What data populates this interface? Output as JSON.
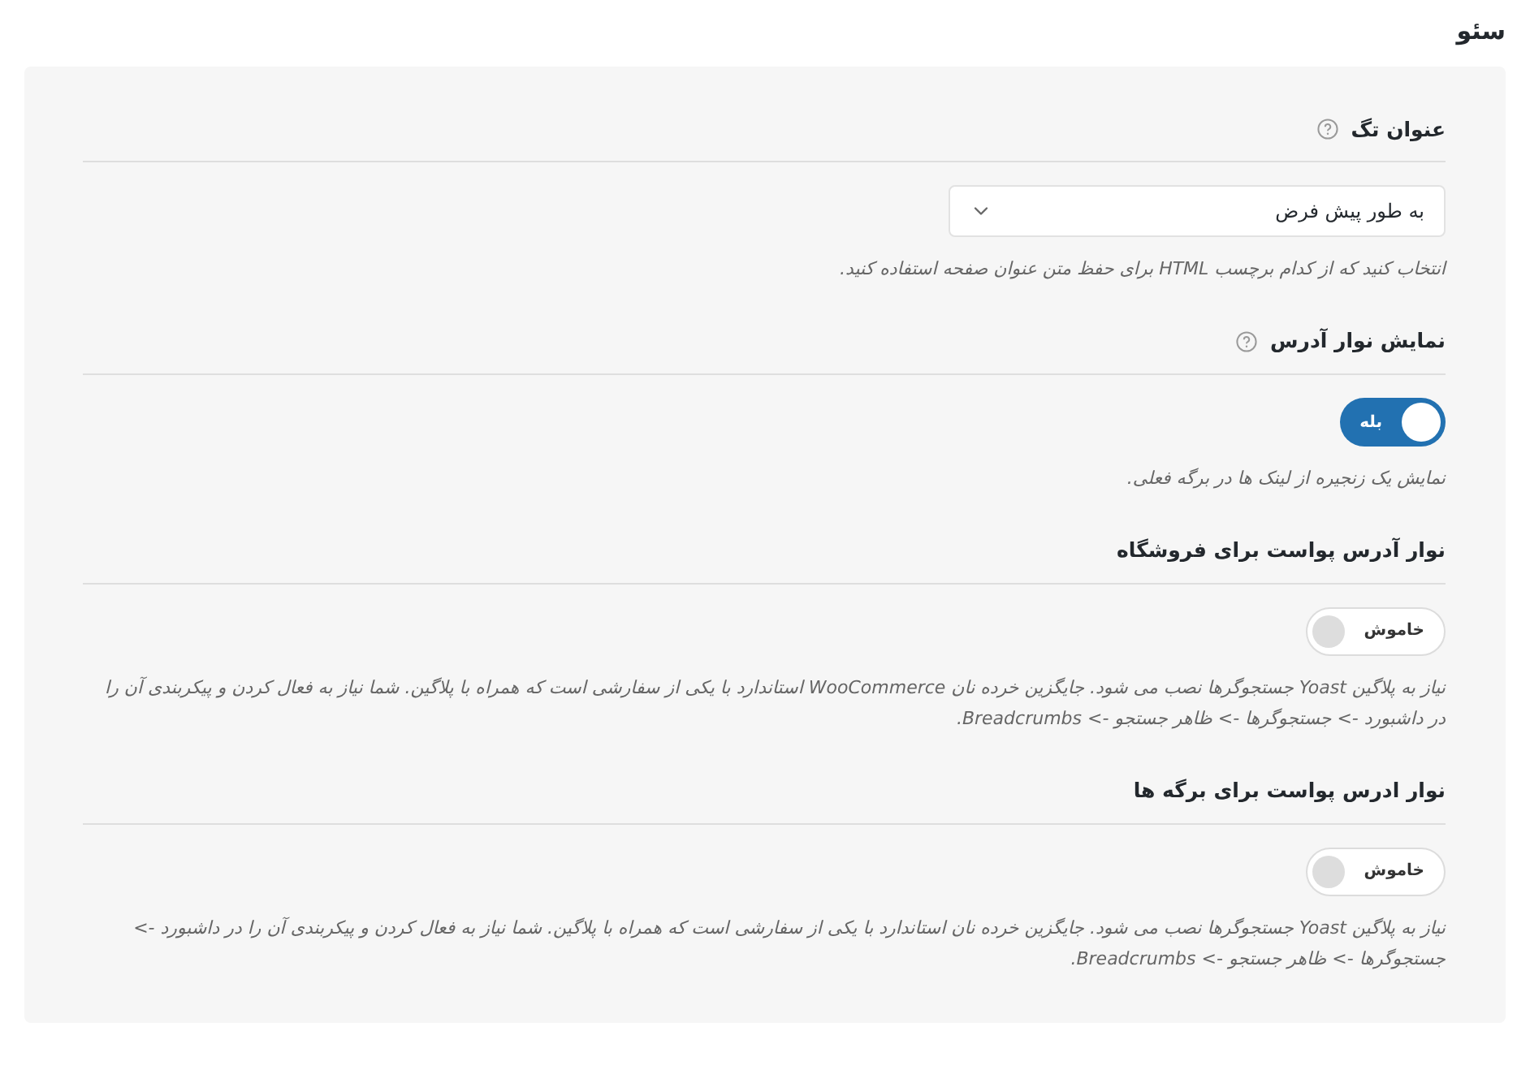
{
  "page_title": "سئو",
  "sections": [
    {
      "kind": "select",
      "title": "عنوان تگ",
      "help_icon": true,
      "value": "به طور پیش فرض",
      "description": "انتخاب کنید که از کدام برچسب HTML برای حفظ متن عنوان صفحه استفاده کنید."
    },
    {
      "kind": "toggle",
      "title": "نمایش نوار آدرس",
      "help_icon": true,
      "on": true,
      "toggle_label": "بله",
      "description": "نمایش یک زنجیره از لینک ها در برگه فعلی."
    },
    {
      "kind": "toggle",
      "title": "نوار آدرس پواست برای فروشگاه",
      "help_icon": false,
      "on": false,
      "toggle_label": "خاموش",
      "description": "نیاز به پلاگین Yoast جستجوگرها نصب می شود. جایگزین خرده نان WooCommerce استاندارد با یکی از سفارشی است که همراه با پلاگین. شما نیاز به فعال کردن و پیکربندی آن را در داشبورد -> جستجوگرها -> ظاهر جستجو -> Breadcrumbs."
    },
    {
      "kind": "toggle",
      "title": "نوار ادرس پواست برای برگه ها",
      "help_icon": false,
      "on": false,
      "toggle_label": "خاموش",
      "description": "نیاز به پلاگین Yoast جستجوگرها نصب می شود. جایگزین خرده نان استاندارد با یکی از سفارشی است که همراه با پلاگین. شما نیاز به فعال کردن و پیکربندی آن را در داشبورد -> جستجوگرها -> ظاهر جستجو -> Breadcrumbs."
    }
  ]
}
